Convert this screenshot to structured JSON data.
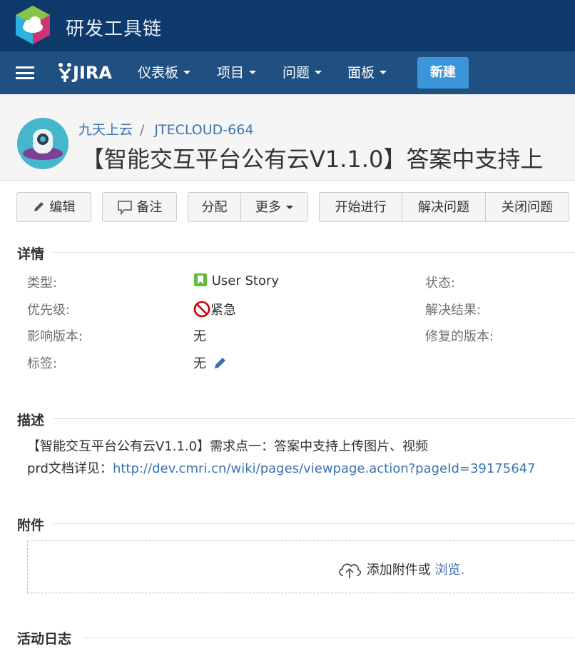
{
  "topbar": {
    "brand": "研发工具链"
  },
  "nav": {
    "jira_label": "JIRA",
    "dashboard": "仪表板",
    "projects": "项目",
    "issues": "问题",
    "boards": "面板",
    "create": "新建"
  },
  "issue": {
    "project": "九天上云",
    "key": "JTECLOUD-664",
    "title": "【智能交互平台公有云V1.1.0】答案中支持上"
  },
  "toolbar": {
    "edit": "编辑",
    "comment": "备注",
    "assign": "分配",
    "more": "更多",
    "start": "开始进行",
    "resolve": "解决问题",
    "close": "关闭问题"
  },
  "details": {
    "heading": "详情",
    "type_label": "类型:",
    "type_value": "User Story",
    "priority_label": "优先级:",
    "priority_value": "紧急",
    "affects_label": "影响版本:",
    "affects_value": "无",
    "labels_label": "标签:",
    "labels_value": "无",
    "status_label": "状态:",
    "resolution_label": "解决结果:",
    "fix_label": "修复的版本:"
  },
  "description": {
    "heading": "描述",
    "line1": "【智能交互平台公有云V1.1.0】需求点一：答案中支持上传图片、视频",
    "line2_prefix": "prd文档详见：",
    "link": "http://dev.cmri.cn/wiki/pages/viewpage.action?pageId=39175647"
  },
  "attachments": {
    "heading": "附件",
    "drop_text": "添加附件或",
    "browse": "浏览."
  },
  "activity": {
    "heading": "活动日志"
  },
  "colors": {
    "topbar": "#0d3a6b",
    "navbar": "#205081",
    "create": "#3b95d9",
    "link": "#3b73af",
    "story_icon": "#63ba3c",
    "priority_icon": "#cc0000"
  }
}
